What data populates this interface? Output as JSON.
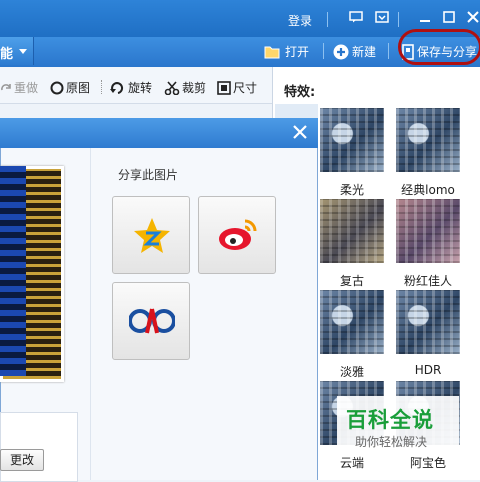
{
  "titlebar": {
    "login_label": "登录",
    "window_buttons": [
      "menu-icon",
      "skin-icon",
      "minimize-icon",
      "maximize-icon",
      "close-icon"
    ]
  },
  "toolbar": {
    "menu_label": "能",
    "open_label": "打开",
    "new_label": "新建",
    "save_share_label": "保存与分享"
  },
  "edit_toolbar": {
    "redo_label": "重做",
    "original_label": "原图",
    "rotate_label": "旋转",
    "crop_label": "裁剪",
    "size_label": "尺寸"
  },
  "effects": {
    "title": "特效:",
    "items": [
      {
        "label": "柔光"
      },
      {
        "label": "经典lomo"
      },
      {
        "label": "复古"
      },
      {
        "label": "粉红佳人"
      },
      {
        "label": "淡雅"
      },
      {
        "label": "HDR"
      },
      {
        "label": "云端"
      },
      {
        "label": "阿宝色"
      }
    ]
  },
  "share_dialog": {
    "close_icon": "close-icon",
    "share_title": "分享此图片",
    "services": [
      {
        "name": "qzone-icon"
      },
      {
        "name": "weibo-icon"
      },
      {
        "name": "renren-icon"
      }
    ],
    "change_label": "更改"
  },
  "watermark": {
    "title": "百科全说",
    "subtitle": "助你轻松解决"
  },
  "colors": {
    "titlebar_blue": "#1f6fc4",
    "highlight_red": "#b01010",
    "watermark_green": "#1a9e3a"
  }
}
